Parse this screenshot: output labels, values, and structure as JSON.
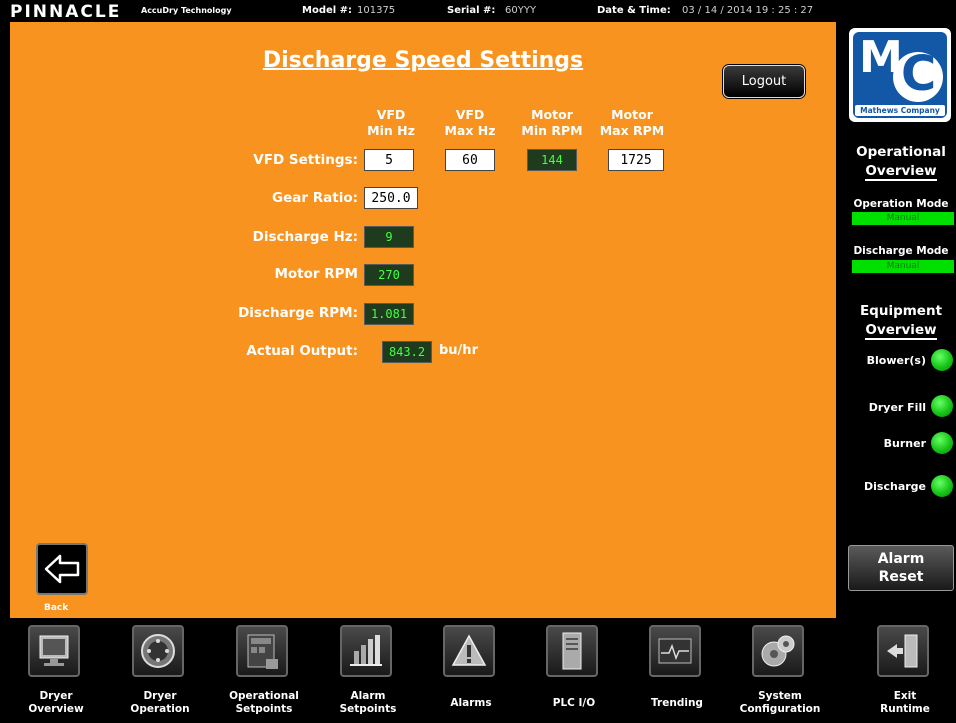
{
  "topbar": {
    "brand": "PINNACLE",
    "brand_sub": "AccuDry Technology",
    "model_label": "Model #:",
    "model_value": "101375",
    "serial_label": "Serial #:",
    "serial_value": "60YYY",
    "datetime_label": "Date & Time:",
    "datetime_value": "03 / 14 / 2014  19 : 25 : 27"
  },
  "main": {
    "title": "Discharge Speed Settings",
    "logout_label": "Logout",
    "columns": [
      {
        "line1": "VFD",
        "line2": "Min Hz"
      },
      {
        "line1": "VFD",
        "line2": "Max Hz"
      },
      {
        "line1": "Motor",
        "line2": "Min RPM"
      },
      {
        "line1": "Motor",
        "line2": "Max RPM"
      }
    ],
    "vfd_settings": {
      "label": "VFD Settings:",
      "min_hz": "5",
      "max_hz": "60",
      "motor_min_rpm": "144",
      "motor_max_rpm": "1725"
    },
    "gear_ratio": {
      "label": "Gear Ratio:",
      "value": "250.0"
    },
    "discharge_hz": {
      "label": "Discharge Hz:",
      "value": "9"
    },
    "motor_rpm": {
      "label": "Motor RPM",
      "value": "270"
    },
    "discharge_rpm": {
      "label": "Discharge RPM:",
      "value": "1.081"
    },
    "actual_output": {
      "label": "Actual Output:",
      "value": "843.2",
      "unit": "bu/hr"
    },
    "back_label": "Back"
  },
  "sidebar": {
    "logo_company": "Mathews Company",
    "logo_letter_1": "M",
    "logo_letter_2": "C",
    "operational_heading_1": "Operational",
    "operational_heading_2": "Overview",
    "operation_mode_label": "Operation Mode",
    "operation_mode_value": "Manual",
    "discharge_mode_label": "Discharge Mode",
    "discharge_mode_value": "Manual",
    "equipment_heading_1": "Equipment",
    "equipment_heading_2": "Overview",
    "equipment": [
      {
        "label": "Blower(s)",
        "status": "on"
      },
      {
        "label": "Dryer Fill",
        "status": "on"
      },
      {
        "label": "Burner",
        "status": "on"
      },
      {
        "label": "Discharge",
        "status": "on"
      }
    ],
    "status_color": "#17c417",
    "alarm_reset_1": "Alarm",
    "alarm_reset_2": "Reset"
  },
  "nav": [
    {
      "label": "Dryer\nOverview",
      "icon": "monitor-icon"
    },
    {
      "label": "Dryer\nOperation",
      "icon": "dial-icon"
    },
    {
      "label": "Operational\nSetpoints",
      "icon": "panel-icon"
    },
    {
      "label": "Alarm\nSetpoints",
      "icon": "chart-hand-icon"
    },
    {
      "label": "Alarms",
      "icon": "warning-icon"
    },
    {
      "label": "PLC I/O",
      "icon": "server-icon"
    },
    {
      "label": "Trending",
      "icon": "trend-icon"
    },
    {
      "label": "System\nConfiguration",
      "icon": "gears-icon"
    },
    {
      "label": "Exit\nRuntime",
      "icon": "exit-door-icon"
    }
  ],
  "colors": {
    "panel": "#f7931e",
    "display_bg": "#1e3b1e",
    "display_text": "#44ff44",
    "mode_green": "#00e000"
  }
}
